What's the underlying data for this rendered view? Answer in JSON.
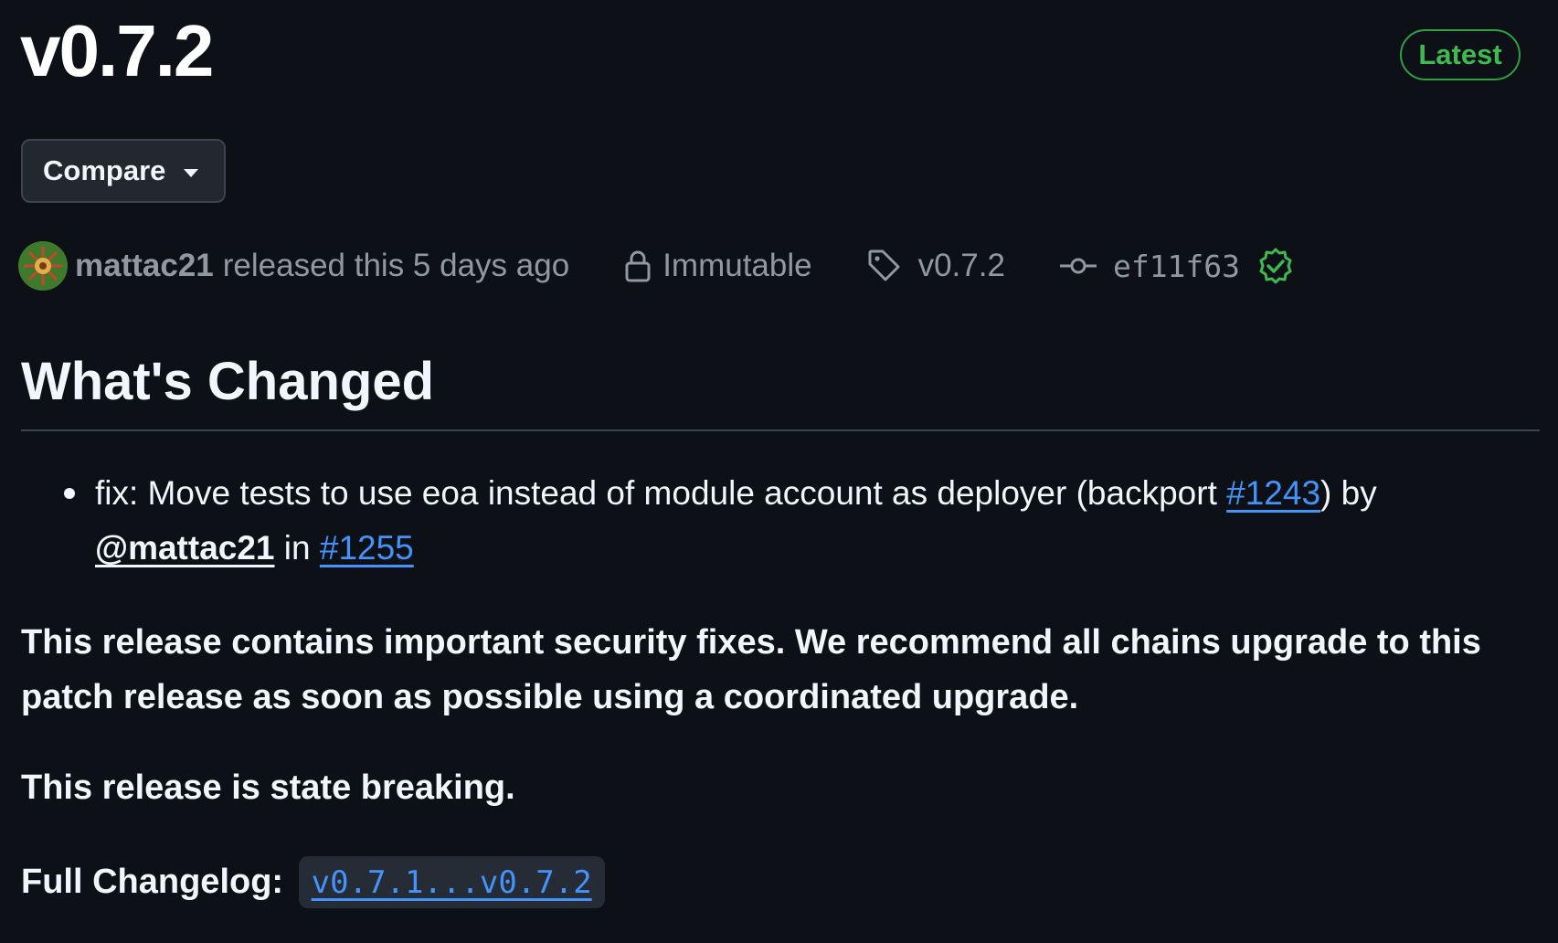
{
  "release": {
    "title": "v0.7.2",
    "latest_badge": "Latest",
    "compare_label": "Compare"
  },
  "meta": {
    "author": "mattac21",
    "released_text": "released this 5 days ago",
    "immutable_label": "Immutable",
    "tag": "v0.7.2",
    "commit": "ef11f63",
    "commit_verified": true
  },
  "body": {
    "heading": "What's Changed",
    "changes": [
      {
        "text_before": "fix: Move tests to use eoa instead of module account as deployer (backport ",
        "backport_link": "#1243",
        "text_by": ") by ",
        "mention": "@mattac21",
        "text_in": " in ",
        "pr_link": "#1255"
      }
    ],
    "security_note": "This release contains important security fixes. We recommend all chains upgrade to this patch release as soon as possible using a coordinated upgrade.",
    "breaking_note": "This release is state breaking.",
    "changelog_label": "Full Changelog:",
    "changelog_link": "v0.7.1...v0.7.2"
  },
  "colors": {
    "background": "#0d1117",
    "accent_green": "#3fb950",
    "link_blue": "#4493f8",
    "muted": "#9198a1"
  },
  "icons": [
    "lock-icon",
    "tag-icon",
    "commit-icon",
    "verified-check-icon",
    "caret-down-icon"
  ]
}
